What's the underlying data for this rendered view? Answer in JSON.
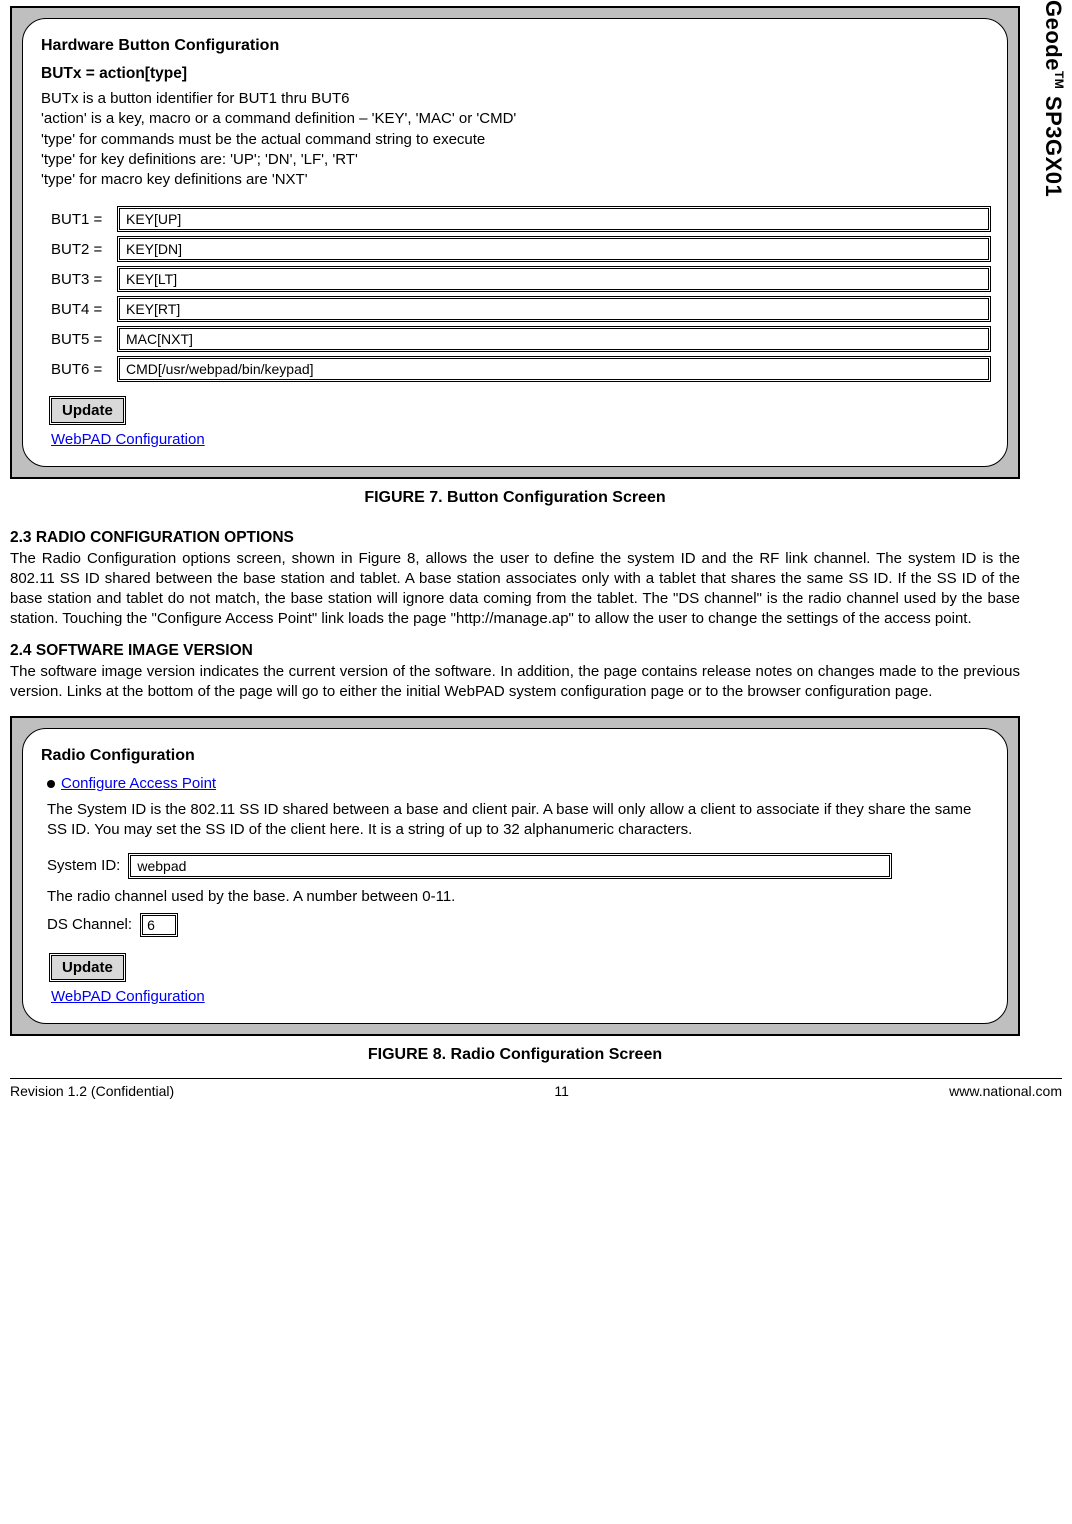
{
  "side_title_pre": "Geode",
  "side_title_tm": "TM",
  "side_title_post": " SP3GX01",
  "panel1": {
    "title": "Hardware Button Configuration",
    "subhead": "BUTx = action[type]",
    "lines": [
      "BUTx is a button identifier for BUT1 thru BUT6",
      "'action' is a key, macro or a command definition – 'KEY', 'MAC' or 'CMD'",
      "'type' for commands must be the actual command string to execute",
      "'type' for key definitions are: 'UP'; 'DN', 'LF', 'RT'",
      "'type' for macro key definitions are 'NXT'"
    ],
    "rows": [
      {
        "label": "BUT1 =",
        "value": "KEY[UP]"
      },
      {
        "label": "BUT2 =",
        "value": "KEY[DN]"
      },
      {
        "label": "BUT3 =",
        "value": "KEY[LT]"
      },
      {
        "label": "BUT4 =",
        "value": "KEY[RT]"
      },
      {
        "label": "BUT5 =",
        "value": "MAC[NXT]"
      },
      {
        "label": "BUT6 =",
        "value": "CMD[/usr/webpad/bin/keypad]"
      }
    ],
    "update": "Update",
    "link": "WebPAD Configuration"
  },
  "fig7": "FIGURE 7.  Button Configuration Screen",
  "sec23_head": "2.3    RADIO CONFIGURATION OPTIONS",
  "sec23_body": "The Radio Configuration options screen, shown in Figure 8, allows the user to define the system ID and the RF link channel. The system ID is the 802.11 SS ID shared between the base station and tablet. A base station associates only with a tablet that shares the same SS ID. If the SS ID of the base station and tablet do not match, the base station will ignore data coming from the tablet. The \"DS channel\" is the radio channel used by the base station. Touching the \"Configure Access Point\" link loads the page \"http://manage.ap\" to allow the user to change the settings of the access point.",
  "sec24_head": "2.4    SOFTWARE IMAGE VERSION",
  "sec24_body": "The software image version indicates the current version of the software. In addition, the page contains release notes on changes made to the previous version. Links at the bottom of the page will go to either the initial WebPAD system configuration page or to the browser configuration page.",
  "panel2": {
    "title": "Radio Configuration",
    "bullet_link": "Configure Access Point",
    "desc": "The System ID is the 802.11 SS ID shared between a base and client pair. A base will only allow a client to associate if they share the same SS ID. You may set the SS ID of the client here. It is a string of up to 32 alphanumeric characters.",
    "sysid_label": "System ID:",
    "sysid_value": "webpad",
    "ds_desc": "The radio channel used by the base. A number between 0-11.",
    "ds_label": "DS Channel:",
    "ds_value": "6",
    "update": "Update",
    "link": "WebPAD Configuration"
  },
  "fig8": "FIGURE 8.  Radio Configuration Screen",
  "footer": {
    "left": "Revision 1.2 (Confidential)",
    "mid": "11",
    "right": "www.national.com"
  }
}
